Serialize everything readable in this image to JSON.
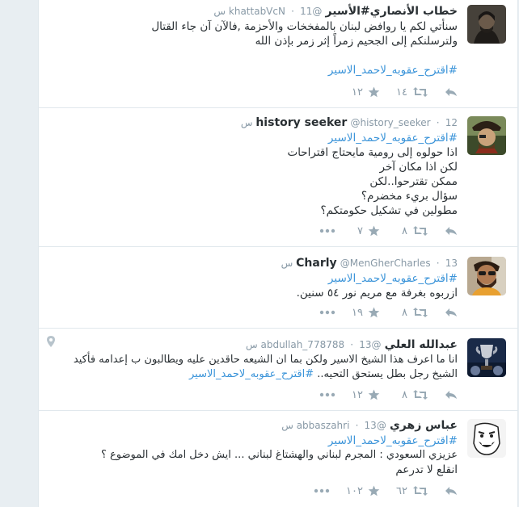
{
  "colors": {
    "link": "#3b94d9",
    "text": "#292f33",
    "muted": "#8899a6",
    "icon": "#99aab5"
  },
  "tweets": [
    {
      "fullname": "خطاب الأنصاري#الأسير",
      "username": "@khattabVcN",
      "time": "11 س",
      "lines": [
        "سنأتي لكم يا روافض لبنان بالمفخخات والأحزمة  ,فالآن آن جاء القتال",
        "ولترسلنكم إلى الجحيم زمراً إثر زمر بإذن الله"
      ],
      "hashtag_line": "#اقترح_عقوبه_لاحمد_الاسير",
      "retweets": "١٤",
      "favorites": "١٢",
      "avatar_icon": "person-dark-avatar"
    },
    {
      "fullname": "history seeker",
      "username": "@history_seeker",
      "time": "12 س",
      "hashtag_line": "#اقترح_عقوبه_لاحمد_الاسير",
      "lines": [
        "اذا حولوه إلى رومية مايحتاج اقتراحات",
        "لكن اذا مكان آخر",
        "ممكن تقترحوا..لكن",
        "سؤال بريء مخضرم؟",
        "مطولين في تشكيل حكومتكم؟"
      ],
      "retweets": "٨",
      "favorites": "٧",
      "avatar_icon": "pirate-avatar"
    },
    {
      "fullname": "Charly",
      "username": "@MenGherCharles",
      "time": "13 س",
      "hashtag_line": "#اقترح_عقوبه_لاحمد_الاسير",
      "lines": [
        "ازربوه بغرفة مع مريم نور ٥٤ سنين."
      ],
      "retweets": "٨",
      "favorites": "١٩",
      "avatar_icon": "bearded-man-avatar"
    },
    {
      "fullname": "عبدالله العلي",
      "username": "@abdullah_778788",
      "time": "13 س",
      "lines": [
        "انا ما اعرف هذا الشيخ الاسير ولكن بما ان الشيعه حاقدين عليه ويطالبون ب إعدامه فأكيد",
        "الشيخ  رجل بطل يستحق التحيه.."
      ],
      "inline_hashtag": "#اقترح_عقوبه_لاحمد_الاسير",
      "retweets": "٨",
      "favorites": "١٢",
      "avatar_icon": "trophy-avatar"
    },
    {
      "fullname": "عباس زهري",
      "username": "@abbaszahri",
      "time": "13 س",
      "hashtag_line": "#اقترح_عقوبه_لاحمد_الاسير",
      "lines": [
        "عزيزي السعودي : المجرم لبناني والهشتاغ لبناني ... ايش دخل امك في الموضوع ؟",
        "انقلع لا تدرعم"
      ],
      "retweets": "٦٢",
      "favorites": "١٠٢",
      "avatar_icon": "rage-face-avatar"
    }
  ]
}
